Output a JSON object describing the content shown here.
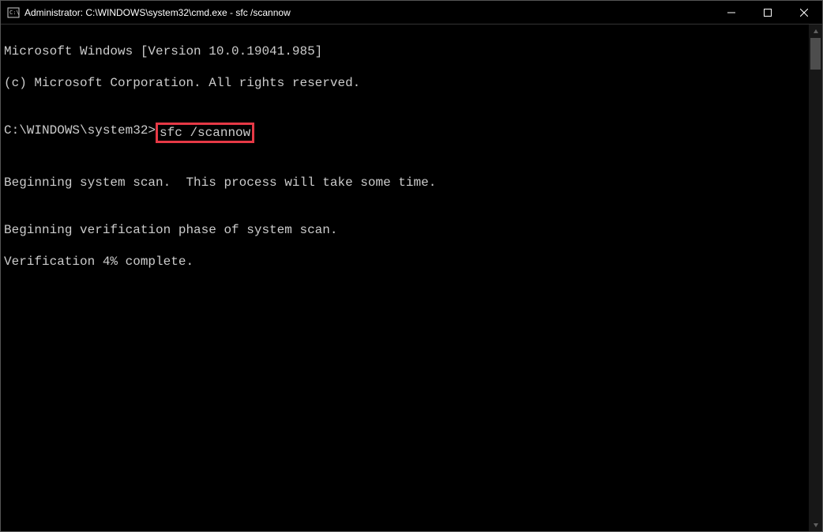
{
  "titlebar": {
    "text": "Administrator: C:\\WINDOWS\\system32\\cmd.exe - sfc  /scannow"
  },
  "terminal": {
    "line1": "Microsoft Windows [Version 10.0.19041.985]",
    "line2": "(c) Microsoft Corporation. All rights reserved.",
    "blank1": "",
    "prompt_path": "C:\\WINDOWS\\system32>",
    "prompt_command": "sfc /scannow",
    "blank2": "",
    "line3": "Beginning system scan.  This process will take some time.",
    "blank3": "",
    "line4": "Beginning verification phase of system scan.",
    "line5": "Verification 4% complete."
  }
}
